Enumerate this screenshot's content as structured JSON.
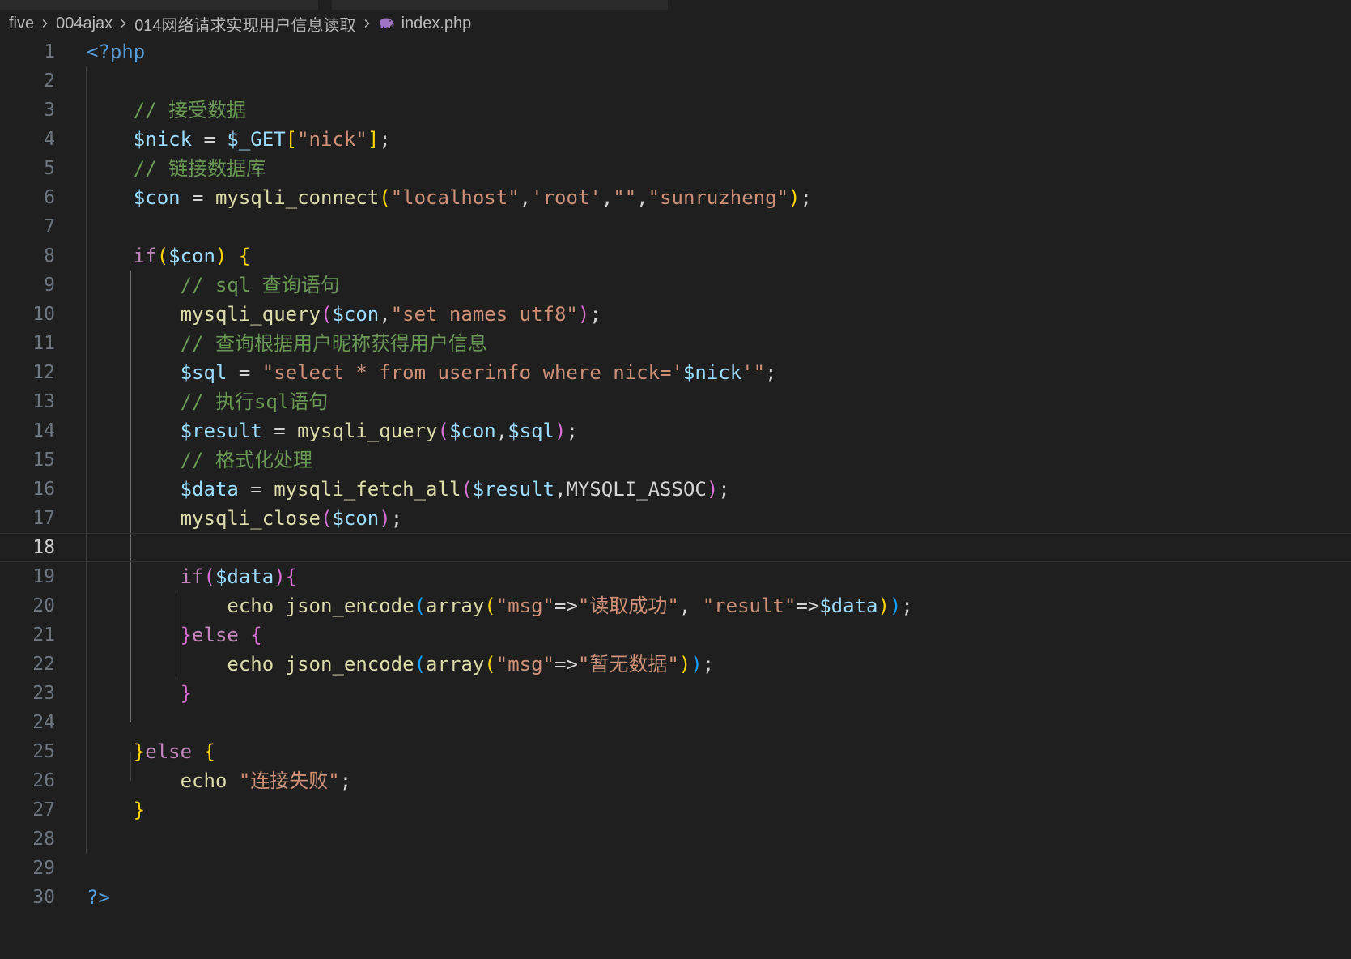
{
  "breadcrumb": {
    "items": [
      "five",
      "004ajax",
      "014网络请求实现用户信息读取"
    ],
    "file": "index.php",
    "file_icon": "php-elephant-icon"
  },
  "editor": {
    "language": "php",
    "current_line": 18,
    "lines": [
      {
        "n": "1",
        "tokens": [
          {
            "t": "<?php",
            "c": "tag"
          }
        ]
      },
      {
        "n": "2",
        "tokens": []
      },
      {
        "n": "3",
        "tokens": [
          {
            "t": "    "
          },
          {
            "t": "// 接受数据",
            "c": "cmt"
          }
        ]
      },
      {
        "n": "4",
        "tokens": [
          {
            "t": "    "
          },
          {
            "t": "$nick",
            "c": "var"
          },
          {
            "t": " = "
          },
          {
            "t": "$_GET",
            "c": "var"
          },
          {
            "t": "[",
            "c": "b1"
          },
          {
            "t": "\"nick\"",
            "c": "str"
          },
          {
            "t": "]",
            "c": "b1"
          },
          {
            "t": ";"
          }
        ]
      },
      {
        "n": "5",
        "tokens": [
          {
            "t": "    "
          },
          {
            "t": "// 链接数据库",
            "c": "cmt"
          }
        ]
      },
      {
        "n": "6",
        "tokens": [
          {
            "t": "    "
          },
          {
            "t": "$con",
            "c": "var"
          },
          {
            "t": " = "
          },
          {
            "t": "mysqli_connect",
            "c": "fn"
          },
          {
            "t": "(",
            "c": "b1"
          },
          {
            "t": "\"localhost\"",
            "c": "str"
          },
          {
            "t": ","
          },
          {
            "t": "'root'",
            "c": "str"
          },
          {
            "t": ","
          },
          {
            "t": "\"\"",
            "c": "str"
          },
          {
            "t": ","
          },
          {
            "t": "\"sunruzheng\"",
            "c": "str"
          },
          {
            "t": ")",
            "c": "b1"
          },
          {
            "t": ";"
          }
        ]
      },
      {
        "n": "7",
        "tokens": []
      },
      {
        "n": "8",
        "tokens": [
          {
            "t": "    "
          },
          {
            "t": "if",
            "c": "kw"
          },
          {
            "t": "(",
            "c": "b1"
          },
          {
            "t": "$con",
            "c": "var"
          },
          {
            "t": ")",
            "c": "b1"
          },
          {
            "t": " "
          },
          {
            "t": "{",
            "c": "b1"
          }
        ]
      },
      {
        "n": "9",
        "tokens": [
          {
            "t": "        "
          },
          {
            "t": "// sql 查询语句",
            "c": "cmt"
          }
        ]
      },
      {
        "n": "10",
        "tokens": [
          {
            "t": "        "
          },
          {
            "t": "mysqli_query",
            "c": "fn"
          },
          {
            "t": "(",
            "c": "b2"
          },
          {
            "t": "$con",
            "c": "var"
          },
          {
            "t": ","
          },
          {
            "t": "\"set names utf8\"",
            "c": "str"
          },
          {
            "t": ")",
            "c": "b2"
          },
          {
            "t": ";"
          }
        ]
      },
      {
        "n": "11",
        "tokens": [
          {
            "t": "        "
          },
          {
            "t": "// 查询根据用户昵称获得用户信息",
            "c": "cmt"
          }
        ]
      },
      {
        "n": "12",
        "tokens": [
          {
            "t": "        "
          },
          {
            "t": "$sql",
            "c": "var"
          },
          {
            "t": " = "
          },
          {
            "t": "\"select * from userinfo where nick='",
            "c": "str"
          },
          {
            "t": "$nick",
            "c": "var"
          },
          {
            "t": "'\"",
            "c": "str"
          },
          {
            "t": ";"
          }
        ]
      },
      {
        "n": "13",
        "tokens": [
          {
            "t": "        "
          },
          {
            "t": "// 执行sql语句",
            "c": "cmt"
          }
        ]
      },
      {
        "n": "14",
        "tokens": [
          {
            "t": "        "
          },
          {
            "t": "$result",
            "c": "var"
          },
          {
            "t": " = "
          },
          {
            "t": "mysqli_query",
            "c": "fn"
          },
          {
            "t": "(",
            "c": "b2"
          },
          {
            "t": "$con",
            "c": "var"
          },
          {
            "t": ","
          },
          {
            "t": "$sql",
            "c": "var"
          },
          {
            "t": ")",
            "c": "b2"
          },
          {
            "t": ";"
          }
        ]
      },
      {
        "n": "15",
        "tokens": [
          {
            "t": "        "
          },
          {
            "t": "// 格式化处理",
            "c": "cmt"
          }
        ]
      },
      {
        "n": "16",
        "tokens": [
          {
            "t": "        "
          },
          {
            "t": "$data",
            "c": "var"
          },
          {
            "t": " = "
          },
          {
            "t": "mysqli_fetch_all",
            "c": "fn"
          },
          {
            "t": "(",
            "c": "b2"
          },
          {
            "t": "$result",
            "c": "var"
          },
          {
            "t": ","
          },
          {
            "t": "MYSQLI_ASSOC",
            "c": "const"
          },
          {
            "t": ")",
            "c": "b2"
          },
          {
            "t": ";"
          }
        ]
      },
      {
        "n": "17",
        "tokens": [
          {
            "t": "        "
          },
          {
            "t": "mysqli_close",
            "c": "fn"
          },
          {
            "t": "(",
            "c": "b2"
          },
          {
            "t": "$con",
            "c": "var"
          },
          {
            "t": ")",
            "c": "b2"
          },
          {
            "t": ";"
          }
        ]
      },
      {
        "n": "18",
        "tokens": []
      },
      {
        "n": "19",
        "tokens": [
          {
            "t": "        "
          },
          {
            "t": "if",
            "c": "kw"
          },
          {
            "t": "(",
            "c": "b2"
          },
          {
            "t": "$data",
            "c": "var"
          },
          {
            "t": ")",
            "c": "b2"
          },
          {
            "t": "{",
            "c": "b2"
          }
        ]
      },
      {
        "n": "20",
        "tokens": [
          {
            "t": "            "
          },
          {
            "t": "echo",
            "c": "fn"
          },
          {
            "t": " "
          },
          {
            "t": "json_encode",
            "c": "fn"
          },
          {
            "t": "(",
            "c": "b3"
          },
          {
            "t": "array",
            "c": "fn"
          },
          {
            "t": "(",
            "c": "b1"
          },
          {
            "t": "\"msg\"",
            "c": "str"
          },
          {
            "t": "=>"
          },
          {
            "t": "\"读取成功\"",
            "c": "str"
          },
          {
            "t": ", "
          },
          {
            "t": "\"result\"",
            "c": "str"
          },
          {
            "t": "=>"
          },
          {
            "t": "$data",
            "c": "var"
          },
          {
            "t": ")",
            "c": "b1"
          },
          {
            "t": ")",
            "c": "b3"
          },
          {
            "t": ";"
          }
        ]
      },
      {
        "n": "21",
        "tokens": [
          {
            "t": "        "
          },
          {
            "t": "}",
            "c": "b2"
          },
          {
            "t": "else",
            "c": "kw"
          },
          {
            "t": " "
          },
          {
            "t": "{",
            "c": "b2"
          }
        ]
      },
      {
        "n": "22",
        "tokens": [
          {
            "t": "            "
          },
          {
            "t": "echo",
            "c": "fn"
          },
          {
            "t": " "
          },
          {
            "t": "json_encode",
            "c": "fn"
          },
          {
            "t": "(",
            "c": "b3"
          },
          {
            "t": "array",
            "c": "fn"
          },
          {
            "t": "(",
            "c": "b1"
          },
          {
            "t": "\"msg\"",
            "c": "str"
          },
          {
            "t": "=>"
          },
          {
            "t": "\"暂无数据\"",
            "c": "str"
          },
          {
            "t": ")",
            "c": "b1"
          },
          {
            "t": ")",
            "c": "b3"
          },
          {
            "t": ";"
          }
        ]
      },
      {
        "n": "23",
        "tokens": [
          {
            "t": "        "
          },
          {
            "t": "}",
            "c": "b2"
          }
        ]
      },
      {
        "n": "24",
        "tokens": []
      },
      {
        "n": "25",
        "tokens": [
          {
            "t": "    "
          },
          {
            "t": "}",
            "c": "b1"
          },
          {
            "t": "else",
            "c": "kw"
          },
          {
            "t": " "
          },
          {
            "t": "{",
            "c": "b1"
          }
        ]
      },
      {
        "n": "26",
        "tokens": [
          {
            "t": "        "
          },
          {
            "t": "echo",
            "c": "fn"
          },
          {
            "t": " "
          },
          {
            "t": "\"连接失败\"",
            "c": "str"
          },
          {
            "t": ";"
          }
        ]
      },
      {
        "n": "27",
        "tokens": [
          {
            "t": "    "
          },
          {
            "t": "}",
            "c": "b1"
          }
        ]
      },
      {
        "n": "28",
        "tokens": []
      },
      {
        "n": "29",
        "tokens": []
      },
      {
        "n": "30",
        "tokens": [
          {
            "t": "?>",
            "c": "tag"
          }
        ]
      }
    ]
  }
}
